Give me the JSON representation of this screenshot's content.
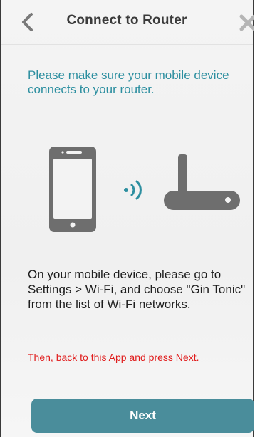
{
  "header": {
    "title": "Connect to Router",
    "back_icon": "chevron-left-icon",
    "close_icon": "close-icon"
  },
  "content": {
    "intro_text": "Please make sure your mobile device connects to your router.",
    "instructions": "On your mobile device, please go to Settings > Wi-Fi, and choose \"Gin Tonic\" from the list of Wi-Fi networks.",
    "then_text": "Then, back to this App and press Next."
  },
  "illustration": {
    "phone_icon": "smartphone-icon",
    "signal_icon": "wifi-signal-icon",
    "router_icon": "router-icon"
  },
  "footer": {
    "next_label": "Next"
  },
  "colors": {
    "accent_teal": "#2d8fa0",
    "button": "#4a8d9b",
    "warning_red": "#e01b1b",
    "icon_gray": "#6e6e6e"
  }
}
